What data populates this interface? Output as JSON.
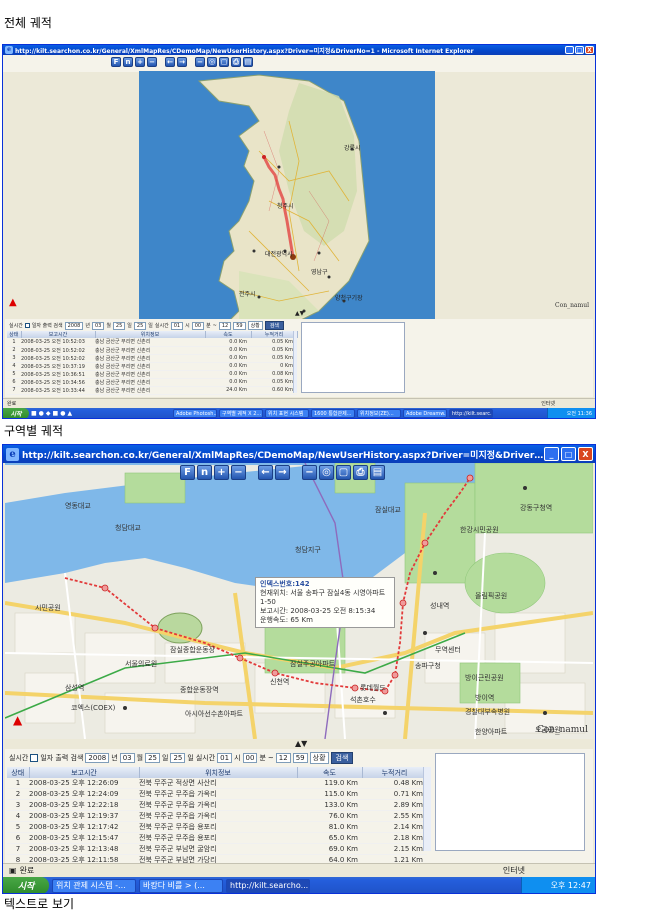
{
  "captions": {
    "full": "전체 궤적",
    "zone": "구역별 궤적",
    "text": "텍스트로 보기"
  },
  "window": {
    "title_top": "http://kilt.searchon.co.kr/General/XmlMapRes/CDemoMap/NewUserHistory.aspx?Driver=미지정&DriverNo=1 - Microsoft Internet Explorer",
    "title_bottom": "http://kilt.searchon.co.kr/General/XmlMapRes/CDemoMap/NewUserHistory.aspx?Driver=미지정&DriverNo=1 - Microsoft Internet Explorer",
    "controls": [
      "_",
      "□",
      "X"
    ]
  },
  "map_toolbar": [
    "F",
    "n",
    "+",
    "−",
    "←",
    "→",
    "−",
    "◎",
    "▢",
    "⎙",
    "▤"
  ],
  "map": {
    "copyright": "Con_namul",
    "splitter": "▲▼",
    "top_labels": [
      "강릉시",
      "청주시",
      "대전광역시",
      "영남구",
      "양천구기장",
      "전주시"
    ],
    "bottom_labels": [
      "잠실대교",
      "영동대교",
      "청담대교",
      "한강시민공원",
      "강동구청역",
      "잠실종합운동장",
      "청담지구",
      "잠실주공아파트",
      "신천역",
      "종합운동장역",
      "아시아선수촌아파트",
      "올림픽공원",
      "석촌호수",
      "삼성역",
      "롯데월드",
      "코엑스(COEX)",
      "서울의료원",
      "시민공원",
      "무역센터",
      "경찰대부속병원",
      "방이근린공원",
      "오금공원",
      "송파구청",
      "방이역",
      "성내역",
      "한양아파트"
    ],
    "popup": {
      "title": "인덱스번호:142",
      "line1": "현재위치: 서울 송파구 잠실4동 시영아파트 1-50",
      "line2": "보고시간: 2008-03-25 오전 8:15:34",
      "line3": "운행속도: 65 Km"
    }
  },
  "history_controls": {
    "realtime_label": "실시간",
    "daily_label": "일자 출력 검색",
    "year": "2008",
    "year_unit": "년",
    "month": "03",
    "month_unit": "월",
    "day": "25",
    "day_unit": "일",
    "day_to": "25",
    "day_to_unit": "일",
    "realtime2": "실시간",
    "hour_from": "01",
    "hour_unit": "시",
    "min_from": "00",
    "min_unit": "분",
    "tilde": "~",
    "hour_to": "12",
    "min_to": "59",
    "mode": "상황",
    "go": "검색"
  },
  "table_top": {
    "headers": [
      "상태",
      "보고시간",
      "위치정보",
      "속도",
      "누적거리"
    ],
    "rows": [
      [
        "1",
        "2008-03-25 오전 10:52:03",
        "충남 금산군 부리면 신촌리",
        "0.0 Km",
        "0.05 Km"
      ],
      [
        "2",
        "2008-03-25 오전 10:52:02",
        "충남 금산군 부리면 신촌리",
        "0.0 Km",
        "0.05 Km"
      ],
      [
        "3",
        "2008-03-25 오전 10:52:02",
        "충남 금산군 부리면 신촌리",
        "0.0 Km",
        "0.05 Km"
      ],
      [
        "4",
        "2008-03-25 오전 10:37:19",
        "충남 금산군 부리면 신촌리",
        "0.0 Km",
        "0 Km"
      ],
      [
        "5",
        "2008-03-25 오전 10:36:51",
        "충남 금산군 부리면 신촌리",
        "0.0 Km",
        "0.08 Km"
      ],
      [
        "6",
        "2008-03-25 오전 10:34:56",
        "충남 금산군 부리면 신촌리",
        "0.0 Km",
        "0.05 Km"
      ],
      [
        "7",
        "2008-03-25 오전 10:33:44",
        "충남 금산군 부리면 신촌리",
        "24.0 Km",
        "0.60 Km"
      ]
    ]
  },
  "table_bottom": {
    "headers": [
      "상태",
      "보고시간",
      "위치정보",
      "속도",
      "누적거리"
    ],
    "rows": [
      [
        "1",
        "2008-03-25 오후 12:26:09",
        "전북 무주군 적상면 사산리",
        "119.0 Km",
        "0.48 Km"
      ],
      [
        "2",
        "2008-03-25 오후 12:24:09",
        "전북 무주군 무주읍 가옥리",
        "115.0 Km",
        "0.71 Km"
      ],
      [
        "3",
        "2008-03-25 오후 12:22:18",
        "전북 무주군 무주읍 가옥리",
        "133.0 Km",
        "2.89 Km"
      ],
      [
        "4",
        "2008-03-25 오후 12:19:37",
        "전북 무주군 무주읍 가옥리",
        "76.0 Km",
        "2.55 Km"
      ],
      [
        "5",
        "2008-03-25 오후 12:17:42",
        "전북 무주군 무주읍 용포리",
        "81.0 Km",
        "2.14 Km"
      ],
      [
        "6",
        "2008-03-25 오후 12:15:47",
        "전북 무주군 무주읍 용포리",
        "65.0 Km",
        "2.18 Km"
      ],
      [
        "7",
        "2008-03-25 오후 12:13:48",
        "전북 무주군 부남면 굴암리",
        "69.0 Km",
        "2.15 Km"
      ],
      [
        "8",
        "2008-03-25 오후 12:11:58",
        "전북 무주군 부남면 가당리",
        "64.0 Km",
        "1.21 Km"
      ]
    ]
  },
  "status": {
    "done": "완료",
    "zone": "인터넷"
  },
  "taskbar_top": {
    "start": "시작",
    "tasks": [
      "Adobe Photosh...",
      "구역별 궤적 X 2...",
      "위치 표현 시스템",
      "1600 통합관제...",
      "위치정보(ZE)...",
      "Adobe Dreamw...",
      "http://kilt.searc..."
    ],
    "clock": "오전 11:36"
  },
  "taskbar_bottom": {
    "start": "시작",
    "tasks": [
      "위치 관제 시스템 -...",
      "바캉다 비를 > (...",
      "http://kilt.searcho..."
    ],
    "clock": "오후 12:47"
  },
  "colors": {
    "title_blue": "#0445c9",
    "taskbar_blue": "#245edc",
    "start_green": "#3c9b39",
    "route_red": "#e23a3a",
    "sea": "#3e86c9"
  }
}
